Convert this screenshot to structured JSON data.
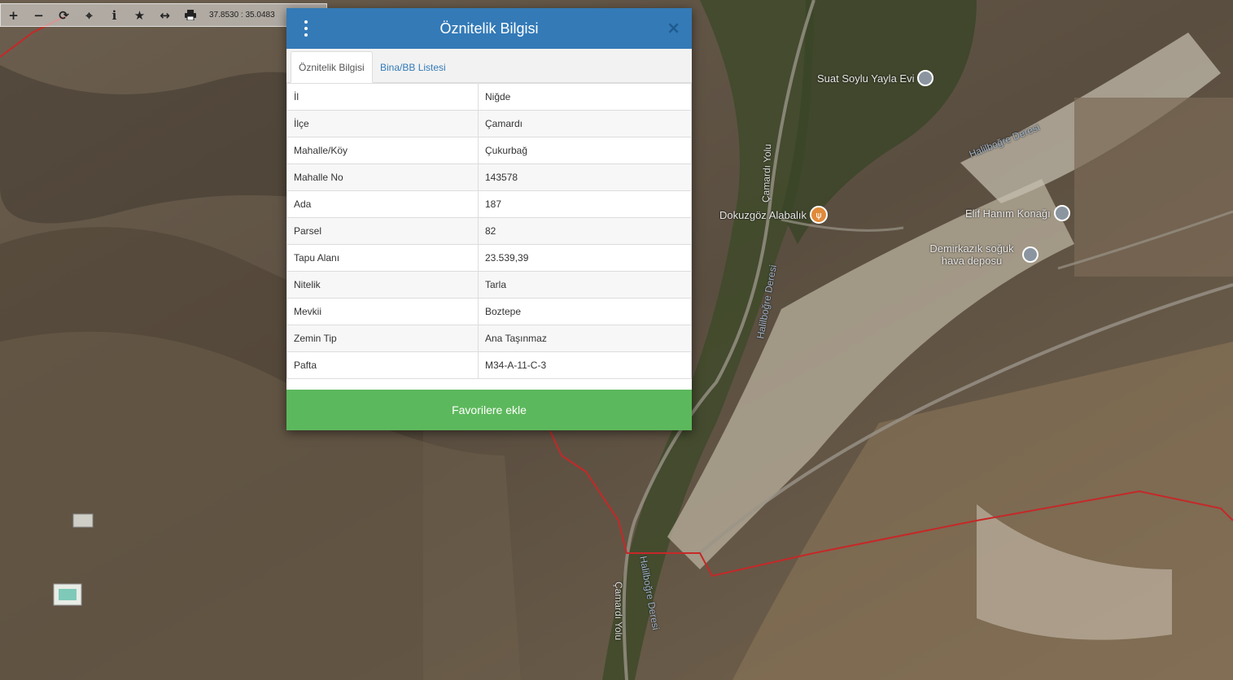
{
  "toolbar": {
    "buttons": [
      {
        "name": "zoom-in-button",
        "icon": "plus-icon"
      },
      {
        "name": "zoom-out-button",
        "icon": "minus-icon"
      },
      {
        "name": "refresh-button",
        "icon": "refresh-icon"
      },
      {
        "name": "locate-button",
        "icon": "crosshair-icon"
      },
      {
        "name": "info-button",
        "icon": "info-icon"
      },
      {
        "name": "favorite-button",
        "icon": "star-icon"
      },
      {
        "name": "measure-button",
        "icon": "arrows-horizontal-icon"
      },
      {
        "name": "print-button",
        "icon": "print-icon"
      }
    ],
    "coordinates": "37.8530 : 35.0483"
  },
  "modal": {
    "title": "Öznitelik Bilgisi",
    "close_label": "×",
    "tabs": [
      "Öznitelik Bilgisi",
      "Bina/BB Listesi"
    ],
    "rows": [
      {
        "key": "İl",
        "value": "Niğde"
      },
      {
        "key": "İlçe",
        "value": "Çamardı"
      },
      {
        "key": "Mahalle/Köy",
        "value": "Çukurbağ"
      },
      {
        "key": "Mahalle No",
        "value": "143578"
      },
      {
        "key": "Ada",
        "value": "187"
      },
      {
        "key": "Parsel",
        "value": "82"
      },
      {
        "key": "Tapu Alanı",
        "value": "23.539,39"
      },
      {
        "key": "Nitelik",
        "value": "Tarla"
      },
      {
        "key": "Mevkii",
        "value": "Boztepe"
      },
      {
        "key": "Zemin Tip",
        "value": "Ana Taşınmaz"
      },
      {
        "key": "Pafta",
        "value": "M34-A-11-C-3"
      }
    ],
    "favorite_label": "Favorilere ekle"
  },
  "map": {
    "places": [
      {
        "name": "Suat Soylu Yayla Evi",
        "icon": "pin-icon"
      },
      {
        "name": "Dokuzgöz Alabalık",
        "icon": "restaurant-icon"
      },
      {
        "name": "Elif Hanım Konağı",
        "icon": "pin-icon"
      },
      {
        "name": "Demirkazık soğuk hava deposu",
        "icon": "pin-icon"
      }
    ],
    "roads": [
      "Çamardı Yolu",
      "Halilboğre Deresi",
      "Halilboğre Deresi",
      "Halilboğre Deresi",
      "Çamardı Yolu"
    ],
    "colors": {
      "boundary": "#c62828",
      "header": "#337ab7",
      "button": "#5cb85c"
    }
  }
}
